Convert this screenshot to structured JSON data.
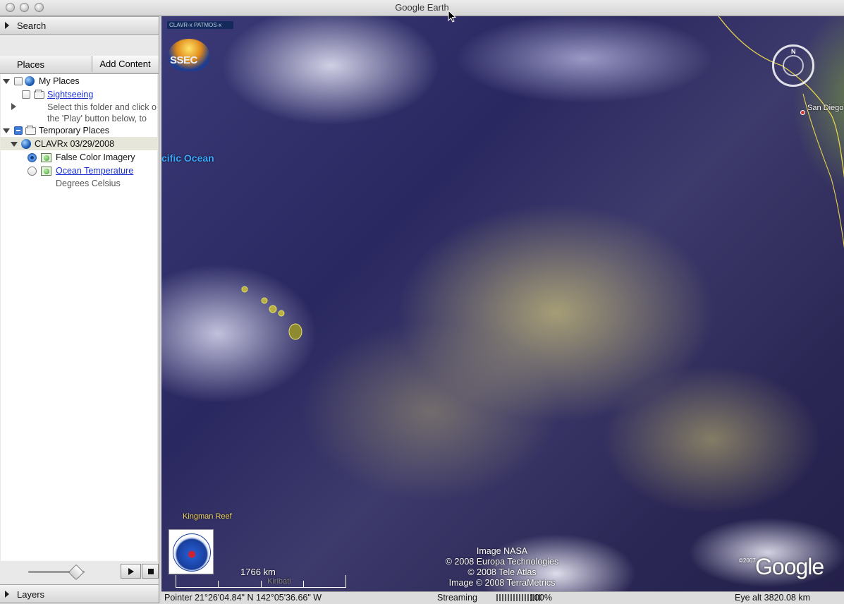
{
  "window": {
    "title": "Google Earth"
  },
  "sidebar": {
    "search_label": "Search",
    "places_label": "Places",
    "add_content_label": "Add Content",
    "layers_label": "Layers",
    "tree": {
      "my_places": "My Places",
      "sightseeing": "Sightseeing",
      "sightseeing_desc_1": "Select this folder and click o",
      "sightseeing_desc_2": "the 'Play' button below, to",
      "temporary_places": "Temporary Places",
      "clavrx": "CLAVRx 03/29/2008",
      "false_color": "False Color Imagery",
      "ocean_temp": "Ocean Temperature",
      "ocean_temp_desc": "Degrees Celsius"
    }
  },
  "map": {
    "banner": "CLAVR-x  PATMOS-x",
    "ssec_logo_text": "SSEC",
    "ocean_label": "cific Ocean",
    "city": "San Diego",
    "kingman": "Kingman Reef",
    "kiribati": "Kiribati",
    "scale_label": "1766 km",
    "credits": [
      "Image NASA",
      "© 2008 Europa Technologies",
      "© 2008 Tele Atlas",
      "Image © 2008 TerraMetrics"
    ],
    "google_logo": "Google",
    "google_year": "©2007"
  },
  "status": {
    "pointer": "Pointer  21°26'04.84\" N  142°05'36.66\" W",
    "streaming_label": "Streaming",
    "streaming_pct": "100%",
    "streaming_value": 1.0,
    "eye_alt": "Eye alt  3820.08 km"
  }
}
